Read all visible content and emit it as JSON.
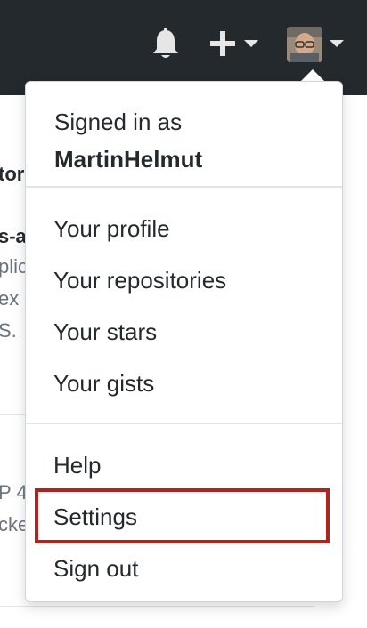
{
  "header": {
    "notifications_icon": "bell-icon",
    "create_icon": "plus-icon",
    "avatar_alt": "avatar"
  },
  "background": {
    "line1": "tor",
    "line2": "s-a",
    "line3": "plic",
    "line4": "ex",
    "line5": "S.",
    "line6": "P 4",
    "line7": "cke"
  },
  "dropdown": {
    "signed_in_prefix": "Signed in as",
    "username": "MartinHelmut",
    "group1": [
      "Your profile",
      "Your repositories",
      "Your stars",
      "Your gists"
    ],
    "group2": [
      "Help",
      "Settings",
      "Sign out"
    ],
    "highlight_color": "#b3231d"
  }
}
